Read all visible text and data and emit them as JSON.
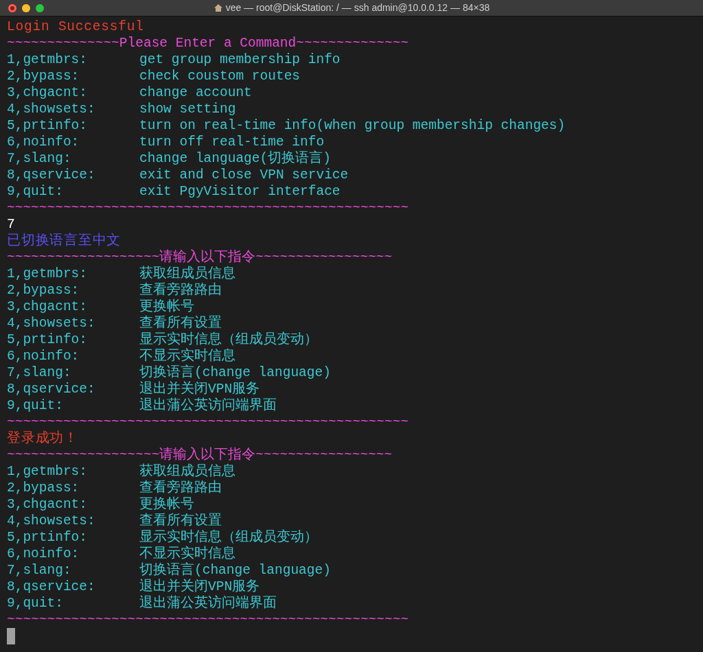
{
  "window": {
    "title": "vee — root@DiskStation: / — ssh admin@10.0.0.12 — 84×38"
  },
  "terminal": {
    "lines": [
      {
        "kind": "text",
        "text": "Login Successful",
        "color": "#e8402c"
      },
      {
        "kind": "rule",
        "text": "~~~~~~~~~~~~~~Please Enter a Command~~~~~~~~~~~~~~",
        "color": "#e84ad8"
      },
      {
        "kind": "command",
        "key": "1,getmbrs:",
        "description": "get group membership info"
      },
      {
        "kind": "command",
        "key": "2,bypass:",
        "description": "check coustom routes"
      },
      {
        "kind": "command",
        "key": "3,chgacnt:",
        "description": "change account"
      },
      {
        "kind": "command",
        "key": "4,showsets:",
        "description": "show setting"
      },
      {
        "kind": "command",
        "key": "5,prtinfo:",
        "description": "turn on real-time info(when group membership changes)"
      },
      {
        "kind": "command",
        "key": "6,noinfo:",
        "description": "turn off real-time info"
      },
      {
        "kind": "command",
        "key": "7,slang:",
        "description": "change language(切换语言)"
      },
      {
        "kind": "command",
        "key": "8,qservice:",
        "description": "exit and close VPN service"
      },
      {
        "kind": "command",
        "key": "9,quit:",
        "description": "exit PgyVisitor interface"
      },
      {
        "kind": "rule",
        "text": "~~~~~~~~~~~~~~~~~~~~~~~~~~~~~~~~~~~~~~~~~~~~~~~~~~",
        "color": "#e84ad8"
      },
      {
        "kind": "text",
        "text": "7",
        "color": "#ffffff"
      },
      {
        "kind": "text",
        "text": "已切换语言至中文",
        "color": "#5b4ff0"
      },
      {
        "kind": "rule",
        "text": "~~~~~~~~~~~~~~~~~~~请输入以下指令~~~~~~~~~~~~~~~~~",
        "color": "#e84ad8"
      },
      {
        "kind": "command",
        "key": "1,getmbrs:",
        "description": "获取组成员信息"
      },
      {
        "kind": "command",
        "key": "2,bypass:",
        "description": "查看旁路路由"
      },
      {
        "kind": "command",
        "key": "3,chgacnt:",
        "description": "更换帐号"
      },
      {
        "kind": "command",
        "key": "4,showsets:",
        "description": "查看所有设置"
      },
      {
        "kind": "command",
        "key": "5,prtinfo:",
        "description": "显示实时信息（组成员变动）"
      },
      {
        "kind": "command",
        "key": "6,noinfo:",
        "description": "不显示实时信息"
      },
      {
        "kind": "command",
        "key": "7,slang:",
        "description": "切换语言(change language)"
      },
      {
        "kind": "command",
        "key": "8,qservice:",
        "description": "退出并关闭VPN服务"
      },
      {
        "kind": "command",
        "key": "9,quit:",
        "description": "退出蒲公英访问端界面"
      },
      {
        "kind": "rule",
        "text": "~~~~~~~~~~~~~~~~~~~~~~~~~~~~~~~~~~~~~~~~~~~~~~~~~~",
        "color": "#e84ad8"
      },
      {
        "kind": "text",
        "text": "登录成功！",
        "color": "#e8402c"
      },
      {
        "kind": "rule",
        "text": "~~~~~~~~~~~~~~~~~~~请输入以下指令~~~~~~~~~~~~~~~~~",
        "color": "#e84ad8"
      },
      {
        "kind": "command",
        "key": "1,getmbrs:",
        "description": "获取组成员信息"
      },
      {
        "kind": "command",
        "key": "2,bypass:",
        "description": "查看旁路路由"
      },
      {
        "kind": "command",
        "key": "3,chgacnt:",
        "description": "更换帐号"
      },
      {
        "kind": "command",
        "key": "4,showsets:",
        "description": "查看所有设置"
      },
      {
        "kind": "command",
        "key": "5,prtinfo:",
        "description": "显示实时信息（组成员变动）"
      },
      {
        "kind": "command",
        "key": "6,noinfo:",
        "description": "不显示实时信息"
      },
      {
        "kind": "command",
        "key": "7,slang:",
        "description": "切换语言(change language)"
      },
      {
        "kind": "command",
        "key": "8,qservice:",
        "description": "退出并关闭VPN服务"
      },
      {
        "kind": "command",
        "key": "9,quit:",
        "description": "退出蒲公英访问端界面"
      },
      {
        "kind": "rule",
        "text": "~~~~~~~~~~~~~~~~~~~~~~~~~~~~~~~~~~~~~~~~~~~~~~~~~~",
        "color": "#e84ad8"
      }
    ]
  }
}
